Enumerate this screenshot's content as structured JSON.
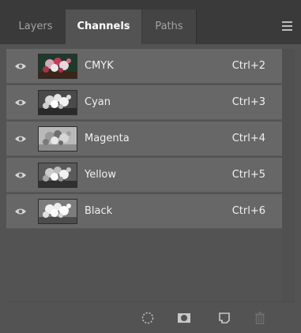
{
  "tabs": [
    {
      "label": "Layers",
      "active": false
    },
    {
      "label": "Channels",
      "active": true
    },
    {
      "label": "Paths",
      "active": false
    }
  ],
  "panel_menu_icon": "hamburger-menu-icon",
  "channels": [
    {
      "name": "CMYK",
      "shortcut": "Ctrl+2",
      "visible": true,
      "thumbnail": "color"
    },
    {
      "name": "Cyan",
      "shortcut": "Ctrl+3",
      "visible": true,
      "thumbnail": "grayscale"
    },
    {
      "name": "Magenta",
      "shortcut": "Ctrl+4",
      "visible": true,
      "thumbnail": "grayscale"
    },
    {
      "name": "Yellow",
      "shortcut": "Ctrl+5",
      "visible": true,
      "thumbnail": "grayscale"
    },
    {
      "name": "Black",
      "shortcut": "Ctrl+6",
      "visible": true,
      "thumbnail": "grayscale"
    }
  ],
  "footer_buttons": [
    {
      "icon": "load-channel-as-selection-icon"
    },
    {
      "icon": "save-selection-as-channel-icon"
    },
    {
      "icon": "new-channel-icon"
    },
    {
      "icon": "delete-channel-icon"
    }
  ],
  "colors": {
    "panel_bg": "#535353",
    "tabbar_bg": "#3a3a3a",
    "row_bg": "#676767",
    "text": "#f0f0f0"
  }
}
